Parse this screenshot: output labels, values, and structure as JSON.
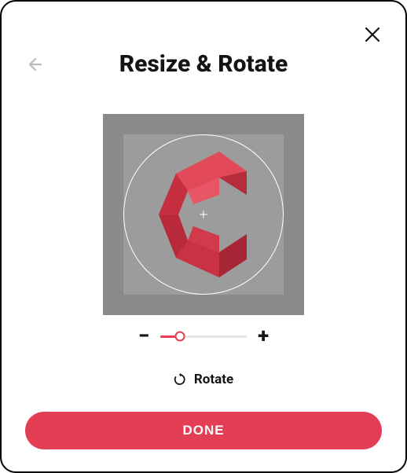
{
  "header": {
    "title": "Resize & Rotate"
  },
  "slider": {
    "value_percent": 23,
    "minus_label": "−",
    "plus_label": "+"
  },
  "rotate": {
    "label": "Rotate"
  },
  "actions": {
    "done_label": "DONE"
  },
  "colors": {
    "accent": "#e33e54"
  }
}
